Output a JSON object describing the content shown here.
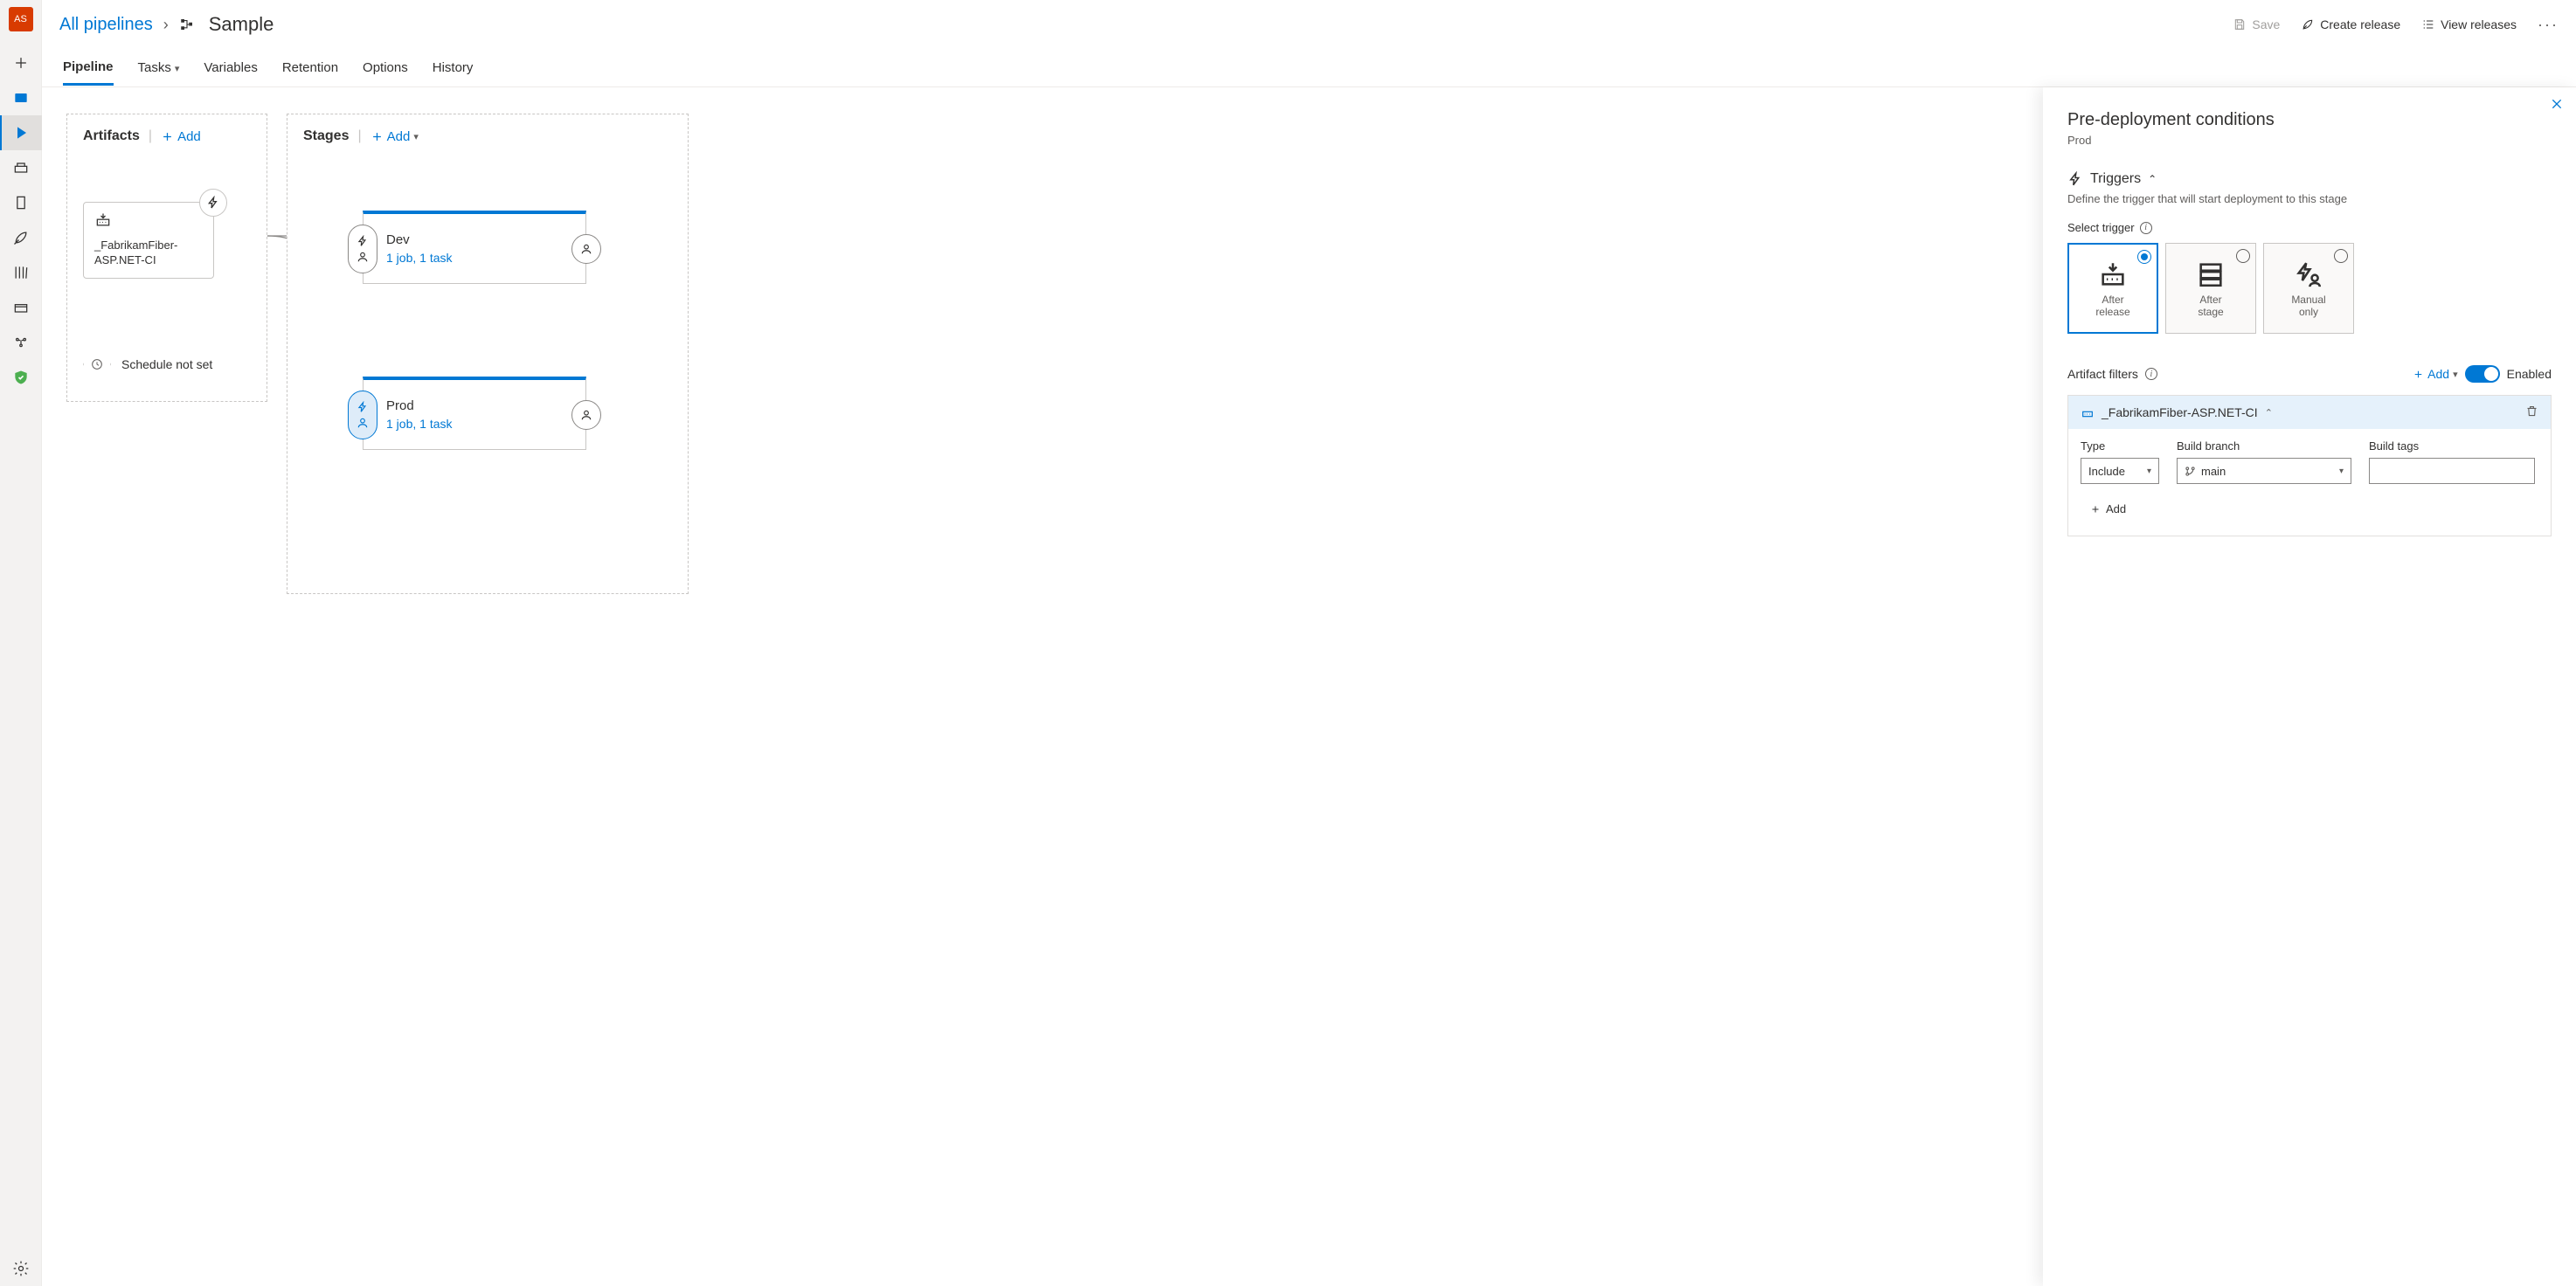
{
  "nav": {
    "avatar": "AS"
  },
  "breadcrumb": {
    "all_pipelines": "All pipelines",
    "current": "Sample"
  },
  "toolbar": {
    "save": "Save",
    "create_release": "Create release",
    "view_releases": "View releases"
  },
  "tabs": {
    "pipeline": "Pipeline",
    "tasks": "Tasks",
    "variables": "Variables",
    "retention": "Retention",
    "options": "Options",
    "history": "History"
  },
  "artifacts": {
    "header": "Artifacts",
    "add": "Add",
    "card_name": "_FabrikamFiber-ASP.NET-CI",
    "schedule_label": "Schedule not set"
  },
  "stages": {
    "header": "Stages",
    "add": "Add",
    "items": [
      {
        "name": "Dev",
        "link": "1 job, 1 task"
      },
      {
        "name": "Prod",
        "link": "1 job, 1 task"
      }
    ]
  },
  "sidepanel": {
    "title": "Pre-deployment conditions",
    "stage": "Prod",
    "triggers_hdr": "Triggers",
    "triggers_desc": "Define the trigger that will start deployment to this stage",
    "select_trigger": "Select trigger",
    "trigger_opts": [
      {
        "line1": "After",
        "line2": "release"
      },
      {
        "line1": "After",
        "line2": "stage"
      },
      {
        "line1": "Manual",
        "line2": "only"
      }
    ],
    "artifact_filters": "Artifact filters",
    "filters_add": "Add",
    "enabled": "Enabled",
    "filter_source": "_FabrikamFiber-ASP.NET-CI",
    "col_type": "Type",
    "col_branch": "Build branch",
    "col_tags": "Build tags",
    "val_type": "Include",
    "val_branch": "main",
    "add_row": "Add"
  }
}
